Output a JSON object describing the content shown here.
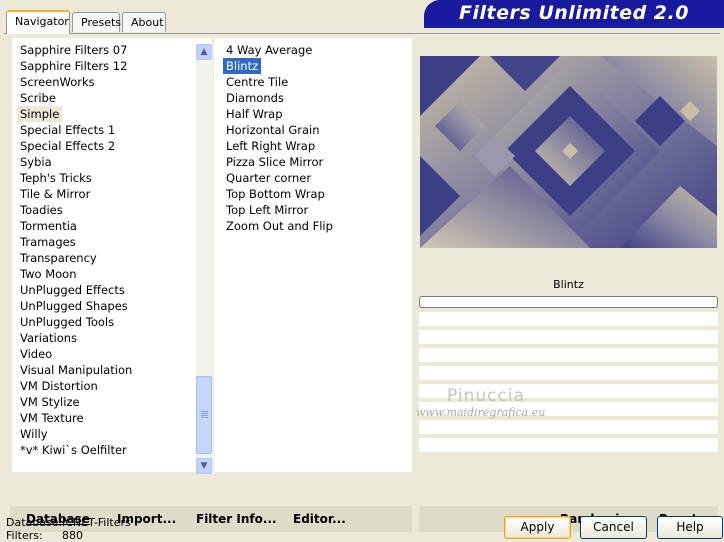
{
  "tabs": [
    "Navigator",
    "Presets",
    "About"
  ],
  "banner_title": "Filters Unlimited 2.0",
  "categories": [
    "Sapphire Filters 07",
    "Sapphire Filters 12",
    "ScreenWorks",
    "Scribe",
    "Simple",
    "Special Effects 1",
    "Special Effects 2",
    "Sybia",
    "Teph's Tricks",
    "Tile & Mirror",
    "Toadies",
    "Tormentia",
    "Tramages",
    "Transparency",
    "Two Moon",
    "UnPlugged Effects",
    "UnPlugged Shapes",
    "UnPlugged Tools",
    "Variations",
    "Video",
    "Visual Manipulation",
    "VM Distortion",
    "VM Stylize",
    "VM Texture",
    "Willy",
    "*v* Kiwi`s Oelfilter"
  ],
  "selected_category": "Simple",
  "filters": [
    "4 Way Average",
    "Blintz",
    "Centre Tile",
    "Diamonds",
    "Half Wrap",
    "Horizontal Grain",
    "Left Right Wrap",
    "Pizza Slice Mirror",
    "Quarter corner",
    "Top Bottom Wrap",
    "Top Left Mirror",
    "Zoom Out and Flip"
  ],
  "selected_filter": "Blintz",
  "preview_filter_name": "Blintz",
  "watermark": {
    "title": "Pinuccia",
    "url": "www.maidiregrafica.eu"
  },
  "bottom_left_buttons": [
    "Database",
    "Import...",
    "Filter Info...",
    "Editor..."
  ],
  "bottom_right_buttons": [
    "Randomize",
    "Reset"
  ],
  "status": {
    "database_label": "Database:",
    "database_value": "ICNET-Filters",
    "filters_label": "Filters:",
    "filters_value": "880"
  },
  "dialog_buttons": {
    "apply": "Apply",
    "cancel": "Cancel",
    "help": "Help"
  },
  "colors": {
    "banner": "#1a1aa0",
    "selection": "#316ac5",
    "preview_blue": "#3d3f86",
    "preview_beige": "#c6bca5"
  }
}
